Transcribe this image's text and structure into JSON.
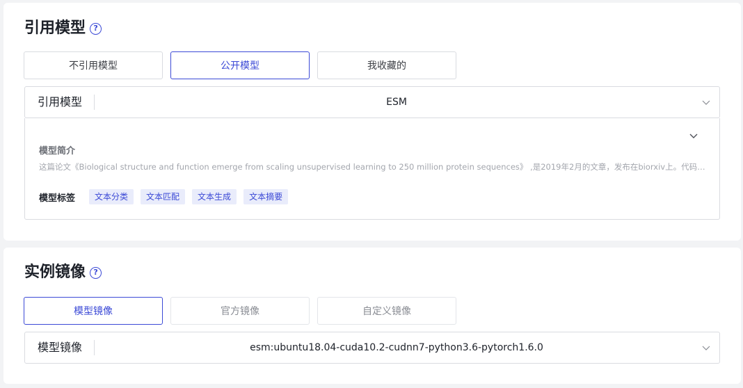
{
  "model_section": {
    "title": "引用模型",
    "tabs": [
      {
        "label": "不引用模型"
      },
      {
        "label": "公开模型"
      },
      {
        "label": "我收藏的"
      }
    ],
    "select": {
      "label": "引用模型",
      "value": "ESM"
    },
    "info": {
      "intro_title": "模型简介",
      "intro_text": "这篇论文《Biological structure and function emerge from scaling unsupervised learning to 250 million protein sequences》 ,是2019年2月的文章，发布在biorxiv上。代码中包含了预训练模型",
      "tags_label": "模型标签",
      "tags": [
        "文本分类",
        "文本匹配",
        "文本生成",
        "文本摘要"
      ]
    }
  },
  "image_section": {
    "title": "实例镜像",
    "tabs": [
      {
        "label": "模型镜像"
      },
      {
        "label": "官方镜像"
      },
      {
        "label": "自定义镜像"
      }
    ],
    "select": {
      "label": "模型镜像",
      "value": "esm:ubuntu18.04-cuda10.2-cudnn7-python3.6-pytorch1.6.0"
    }
  },
  "colors": {
    "accent": "#3b49d6",
    "tag_bg": "#e9ecfb"
  },
  "icons": {
    "help": "help-circle-icon",
    "dropdown": "chevron-down-icon"
  }
}
